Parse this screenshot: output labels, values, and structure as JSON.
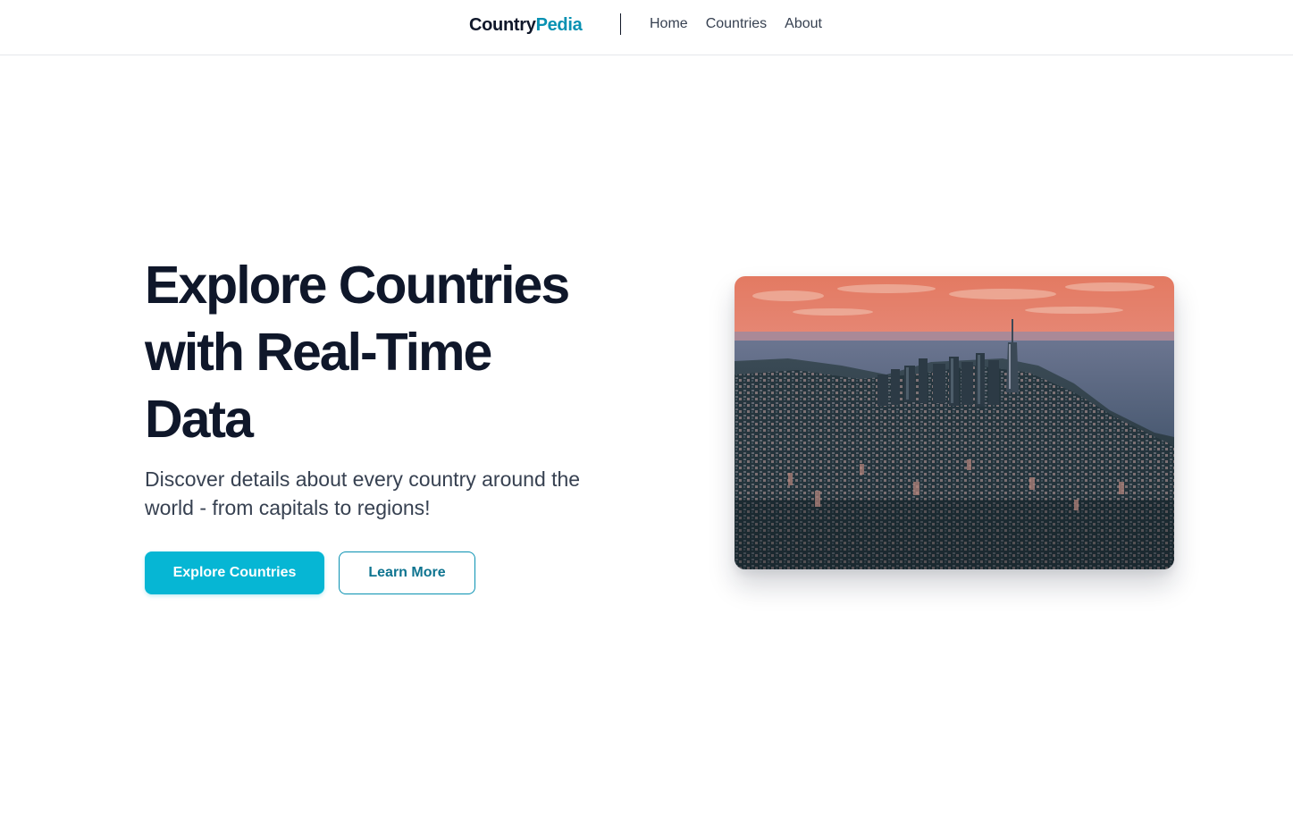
{
  "header": {
    "logo_part1": "Country",
    "logo_part2": "Pedia",
    "nav": [
      {
        "label": "Home"
      },
      {
        "label": "Countries"
      },
      {
        "label": "About"
      }
    ]
  },
  "hero": {
    "title": "Explore Countries with Real-Time Data",
    "subtitle": "Discover details about every country around the world - from capitals to regions!",
    "primary_button": "Explore Countries",
    "secondary_button": "Learn More",
    "image_description_icon": "city-skyline-photo"
  },
  "colors": {
    "accent": "#06b6d4",
    "accent_dark": "#0891b2",
    "text_dark": "#0f172a",
    "text_muted": "#374151"
  }
}
